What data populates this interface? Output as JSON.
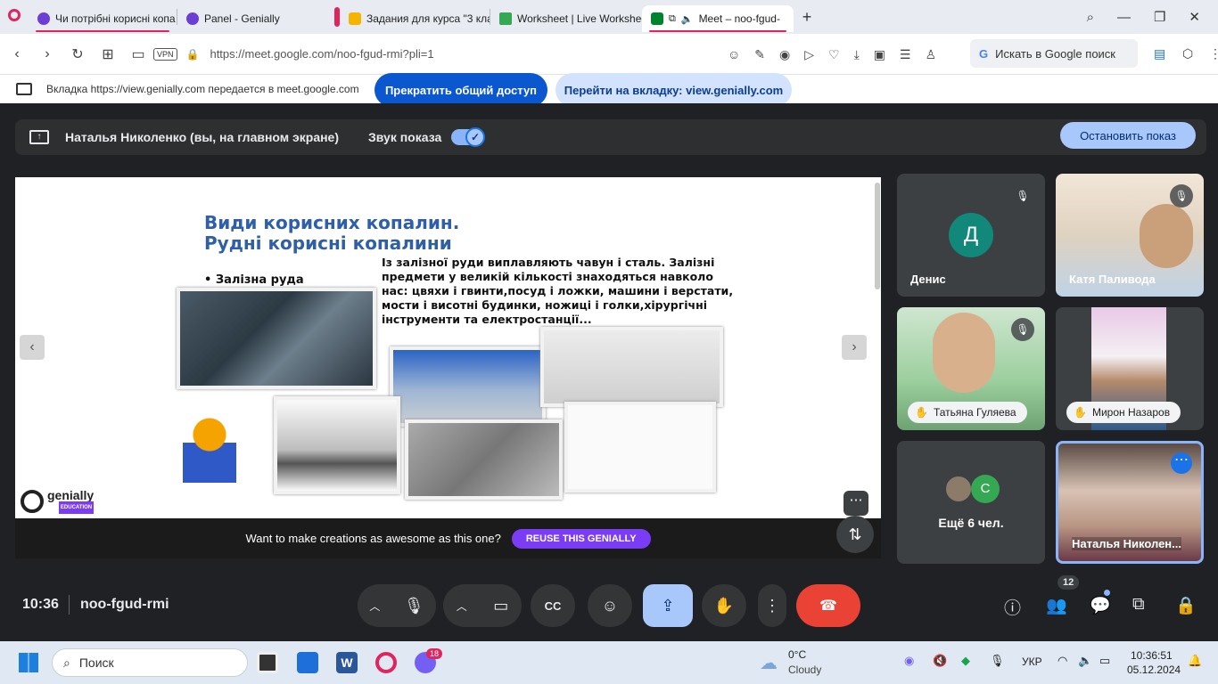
{
  "browser": {
    "tabs": [
      {
        "title": "Чи потрібні корисні копа",
        "color": "#6b3fd6"
      },
      {
        "title": "Panel - Genially",
        "color": "#6b3fd6"
      },
      {
        "title": "Задания для курса \"3 кла",
        "color": "#f4b400"
      },
      {
        "title": "Worksheet | Live Workshee",
        "color": "#34a853"
      },
      {
        "title": "Meet – noo-fgud-",
        "color": "#00832d"
      }
    ],
    "url_host": "https://meet.google.com",
    "url_path": "/noo-fgud-rmi?pli=1",
    "vpn": "VPN",
    "google_search": "Искать в Google поиск"
  },
  "sharebar": {
    "text": "Вкладка https://view.genially.com передается в meet.google.com",
    "stop_label": "Прекратить общий доступ",
    "switch_label": "Перейти на вкладку: view.genially.com"
  },
  "presenting": {
    "label": "Наталья Николенко (вы, на главном экране)",
    "sound_label": "Звук показа",
    "stop_label": "Остановить показ"
  },
  "slide": {
    "title_line1": "Види корисних копалин.",
    "title_line2": "Рудні корисні копалини",
    "bullet": "• Залізна руда",
    "text": "Із залізної руди виплавляють чавун і сталь. Залізні предмети у великій кількості знаходяться навколо нас: цвяхи і гвинти,посуд і ложки, машини і верстати, мости і висотні будинки, ножиці і голки,хірургічні інструменти та електростанції...",
    "cta_text": "Want to make creations as awesome as this one?",
    "cta_button": "REUSE THIS GENIALLY",
    "logo": "genially",
    "logo_sub": "EDUCATION"
  },
  "participants": [
    {
      "name": "Денис",
      "initial": "Д",
      "color": "#12887a"
    },
    {
      "name": "Катя Паливода"
    },
    {
      "name": "Татьяна Гуляева"
    },
    {
      "name": "Мирон Назаров"
    },
    {
      "name": "Ещё 6 чел.",
      "initial": "С",
      "color": "#34a853"
    },
    {
      "name": "Наталья Николен..."
    }
  ],
  "controls": {
    "time": "10:36",
    "meeting_code": "noo-fgud-rmi",
    "participants_count": "12"
  },
  "taskbar": {
    "search": "Поиск",
    "weather_temp": "0°C",
    "weather_desc": "Cloudy",
    "lang": "УКР",
    "clock_time": "10:36:51",
    "clock_date": "05.12.2024",
    "viber_badge": "18"
  }
}
